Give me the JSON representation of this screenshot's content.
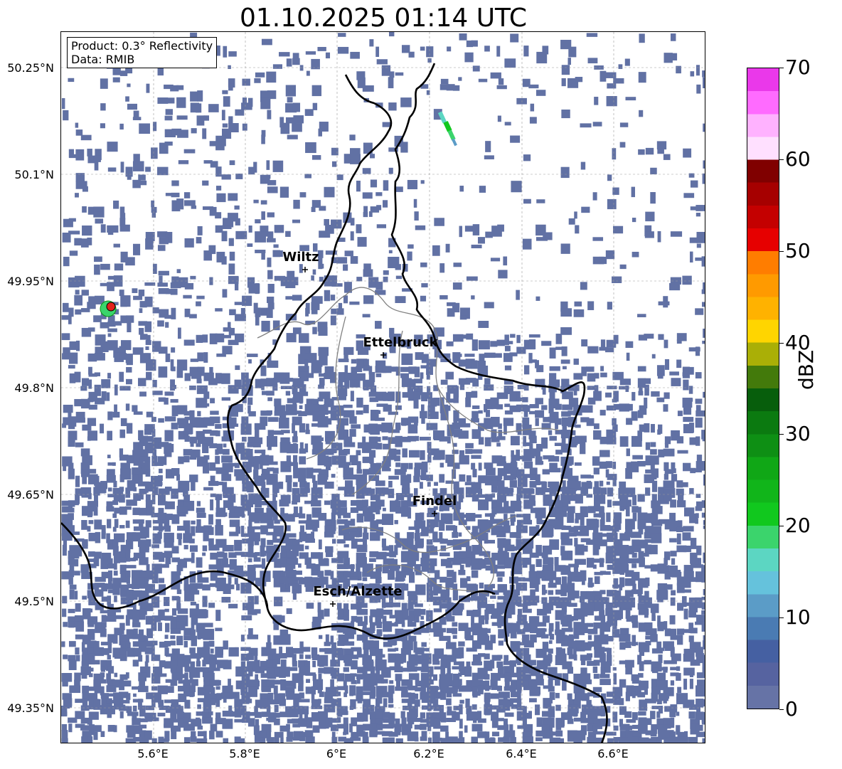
{
  "title": "01.10.2025 01:14 UTC",
  "product_box": {
    "line1": "Product: 0.3° Reflectivity",
    "line2": "Data: RMIB"
  },
  "map": {
    "lat_ticks": [
      "50.25°N",
      "50.1°N",
      "49.95°N",
      "49.8°N",
      "49.65°N",
      "49.5°N",
      "49.35°N"
    ],
    "lon_ticks": [
      "5.6°E",
      "5.8°E",
      "6°E",
      "6.2°E",
      "6.4°E",
      "6.6°E"
    ],
    "cities": [
      {
        "name": "Wiltz"
      },
      {
        "name": "Ettelbruck"
      },
      {
        "name": "Findel"
      },
      {
        "name": "Esch/Alzette"
      }
    ],
    "echo_color": "#6171a4",
    "radar_site_color": "#e3231c"
  },
  "colorbar": {
    "label": "dBZ",
    "ticks": [
      "0",
      "10",
      "20",
      "30",
      "40",
      "50",
      "60",
      "70"
    ],
    "colors": [
      "#6673a6",
      "#5663a0",
      "#4560a2",
      "#4a7bb3",
      "#5b9cc7",
      "#65c2dc",
      "#5cd6c2",
      "#3bd46c",
      "#11c81e",
      "#11b51a",
      "#10a716",
      "#0e8f14",
      "#0b7a10",
      "#075e0c",
      "#437a0b",
      "#aaaf06",
      "#ffd500",
      "#ffb200",
      "#ff9a00",
      "#ff7d00",
      "#e60000",
      "#c40000",
      "#a60000",
      "#800000",
      "#ffe0ff",
      "#ffb2ff",
      "#ff6bff",
      "#ea38ea"
    ]
  }
}
